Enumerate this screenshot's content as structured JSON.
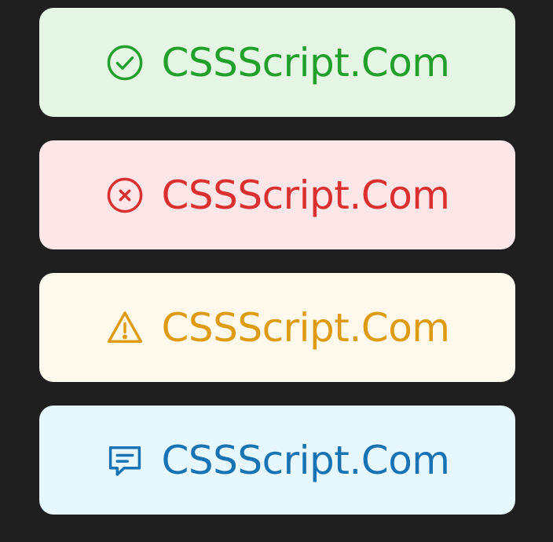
{
  "alerts": [
    {
      "type": "success",
      "icon": "check-circle-icon",
      "text": "CSSScript.Com",
      "color": "#23a02c",
      "background": "#e6f6e4"
    },
    {
      "type": "error",
      "icon": "x-circle-icon",
      "text": "CSSScript.Com",
      "color": "#dc2f2f",
      "background": "#fde6e8"
    },
    {
      "type": "warning",
      "icon": "warning-triangle-icon",
      "text": "CSSScript.Com",
      "color": "#de9a10",
      "background": "#fef9ec"
    },
    {
      "type": "info",
      "icon": "message-icon",
      "text": "CSSScript.Com",
      "color": "#1873b4",
      "background": "#e6f7fe"
    }
  ]
}
